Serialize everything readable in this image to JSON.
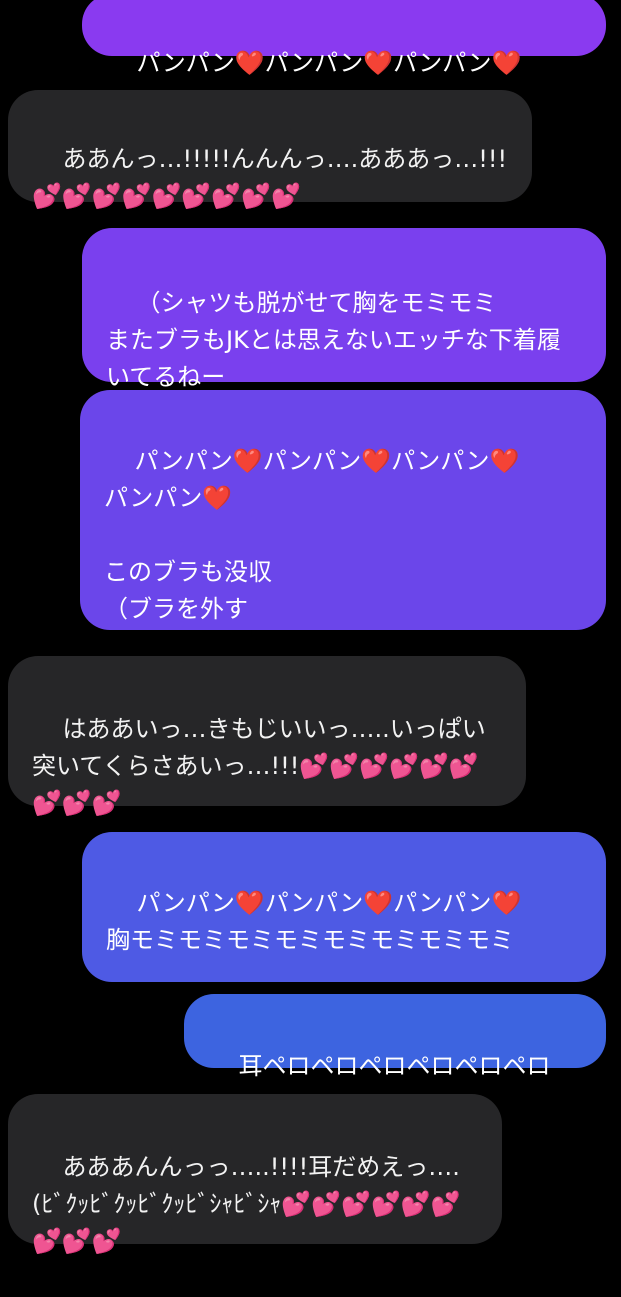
{
  "messages": [
    {
      "from": "sender",
      "text": "パンパン❤️パンパン❤️パンパン❤️"
    },
    {
      "from": "receiver",
      "text": "ああんっ…!!!!!んんんっ….あああっ…!!!💕💕💕💕💕💕💕💕💕"
    },
    {
      "from": "sender",
      "text": "（シャツも脱がせて胸をモミモミ\nまたブラもJKとは思えないエッチな下着履いてるねー"
    },
    {
      "from": "sender",
      "text": "パンパン❤️パンパン❤️パンパン❤️\nパンパン❤️\n\nこのブラも没収\n（ブラを外す"
    },
    {
      "from": "receiver",
      "text": "はああいっ…きもじいいっ…..いっぱい突いてくらさあいっ…!!!💕💕💕💕💕💕💕💕💕"
    },
    {
      "from": "sender",
      "text": "パンパン❤️パンパン❤️パンパン❤️\n胸モミモミモミモミモミモミモミモミ"
    },
    {
      "from": "sender",
      "text": "耳ペロペロペロペロペロペロ"
    },
    {
      "from": "receiver",
      "text": "あああんんっっ…..!!!!耳だめえっ….(ﾋﾞｸｯﾋﾞｸｯﾋﾞｸｯﾋﾞｼｬﾋﾞｼｬ💕💕💕💕💕💕💕💕💕"
    }
  ],
  "colors": {
    "background": "#000000",
    "incoming_bubble": "#262628",
    "outgoing_gradient_top": "#8a3cf0",
    "outgoing_gradient_bottom": "#3a66e0"
  }
}
